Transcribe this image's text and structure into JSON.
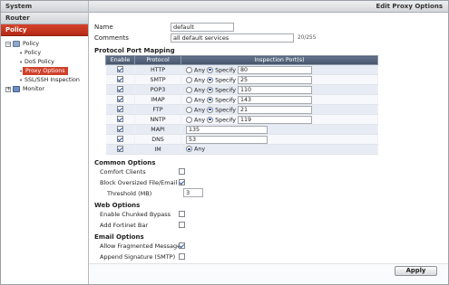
{
  "sidebar": {
    "sections": {
      "system": "System",
      "router": "Router",
      "policy": "Policy"
    },
    "tree": {
      "policy_root": "Policy",
      "items": [
        "Policy",
        "DoS Policy",
        "Proxy Options",
        "SSL/SSH Inspection"
      ],
      "monitor": "Monitor"
    }
  },
  "header": {
    "title": "Edit Proxy Options"
  },
  "form": {
    "name_label": "Name",
    "name_value": "default",
    "comments_label": "Comments",
    "comments_value": "all default services",
    "comments_count": "20/255"
  },
  "mapping": {
    "title": "Protocol Port Mapping",
    "headers": [
      "Enable",
      "Protocol",
      "Inspection Port(s)"
    ],
    "any_label": "Any",
    "specify_label": "Specify",
    "rows": [
      {
        "protocol": "HTTP",
        "port": "80"
      },
      {
        "protocol": "SMTP",
        "port": "25"
      },
      {
        "protocol": "POP3",
        "port": "110"
      },
      {
        "protocol": "IMAP",
        "port": "143"
      },
      {
        "protocol": "FTP",
        "port": "21"
      },
      {
        "protocol": "NNTP",
        "port": "119"
      },
      {
        "protocol": "MAPI",
        "port": "135"
      },
      {
        "protocol": "DNS",
        "port": "53"
      },
      {
        "protocol": "IM",
        "port": ""
      }
    ]
  },
  "common": {
    "title": "Common Options",
    "comfort": "Comfort Clients",
    "block": "Block Oversized File/Email",
    "threshold": "Threshold (MB)",
    "threshold_value": "3"
  },
  "web": {
    "title": "Web Options",
    "chunked": "Enable Chunked Bypass",
    "fortinet": "Add Fortinet Bar"
  },
  "email": {
    "title": "Email Options",
    "fragmented": "Allow Fragmented Messages",
    "signature": "Append Signature (SMTP)"
  },
  "apply_label": "Apply",
  "colors": {
    "accent": "#c8361f",
    "table_header": "#56637a"
  }
}
